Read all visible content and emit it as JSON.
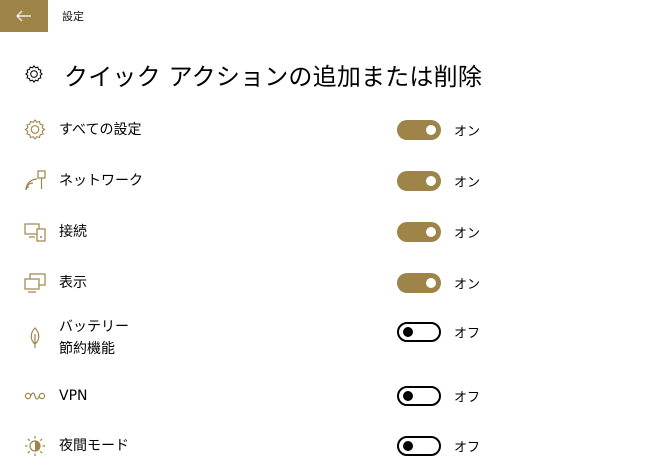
{
  "titlebar": {
    "back_icon": "arrow-left-icon",
    "title": "設定"
  },
  "header": {
    "icon": "gear-icon",
    "title": "クイック アクションの追加または削除"
  },
  "colors": {
    "accent": "#9e8449",
    "background": "#ffffff",
    "text": "#000000"
  },
  "actions": [
    {
      "icon": "gear-icon",
      "label": "すべての設定",
      "on": true,
      "state": "オン"
    },
    {
      "icon": "network-icon",
      "label": "ネットワーク",
      "on": true,
      "state": "オン"
    },
    {
      "icon": "connect-icon",
      "label": "接続",
      "on": true,
      "state": "オン"
    },
    {
      "icon": "display-icon",
      "label": "表示",
      "on": true,
      "state": "オン"
    },
    {
      "icon": "battery-saver-icon",
      "label": "バッテリー\n節約機能",
      "on": false,
      "state": "オフ"
    },
    {
      "icon": "vpn-icon",
      "label": "VPN",
      "on": false,
      "state": "オフ"
    },
    {
      "icon": "night-mode-icon",
      "label": "夜間モード",
      "on": false,
      "state": "オフ"
    }
  ]
}
